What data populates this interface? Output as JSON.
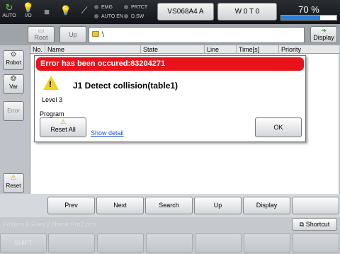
{
  "status_bar": {
    "auto_label": "AUTO",
    "io_label": "I/O",
    "leds": [
      "EMG",
      "AUTO EN",
      "PRTCT",
      "D.SW"
    ],
    "robot_name": "VS068A4 A",
    "workpiece": "W 0 T 0",
    "speed_label": "70 %",
    "speed_value": 0.7
  },
  "path_bar": {
    "root_label": "Root",
    "up_label": "Up",
    "path": "\\",
    "display_label": "Display"
  },
  "side_buttons": {
    "robot": "Robot",
    "var": "Var",
    "error": "Error",
    "reset": "Reset"
  },
  "table": {
    "columns": [
      "No.",
      "Name",
      "State",
      "Line",
      "Time[s]",
      "Priority"
    ]
  },
  "dialog": {
    "title": "Error has been occured:83204271",
    "message": "J1 Detect collision(table1)",
    "level": "Level 3",
    "program_label": "Program",
    "reset_all_label": "Reset All",
    "show_detail": "Show detail",
    "ok_label": "OK"
  },
  "function_keys": [
    "Prev",
    "Next",
    "Search",
    "Up",
    "Display"
  ],
  "status_row": {
    "text": "Folders:0  Files:2  Name:Pro2.pcs",
    "shortcut_label": "Shortcut"
  },
  "shift_row": {
    "shift_label": "SHIFT"
  },
  "colors": {
    "error_red": "#e8121b",
    "accent_blue": "#2b7fd8",
    "warning_yellow": "#f3d21a"
  }
}
